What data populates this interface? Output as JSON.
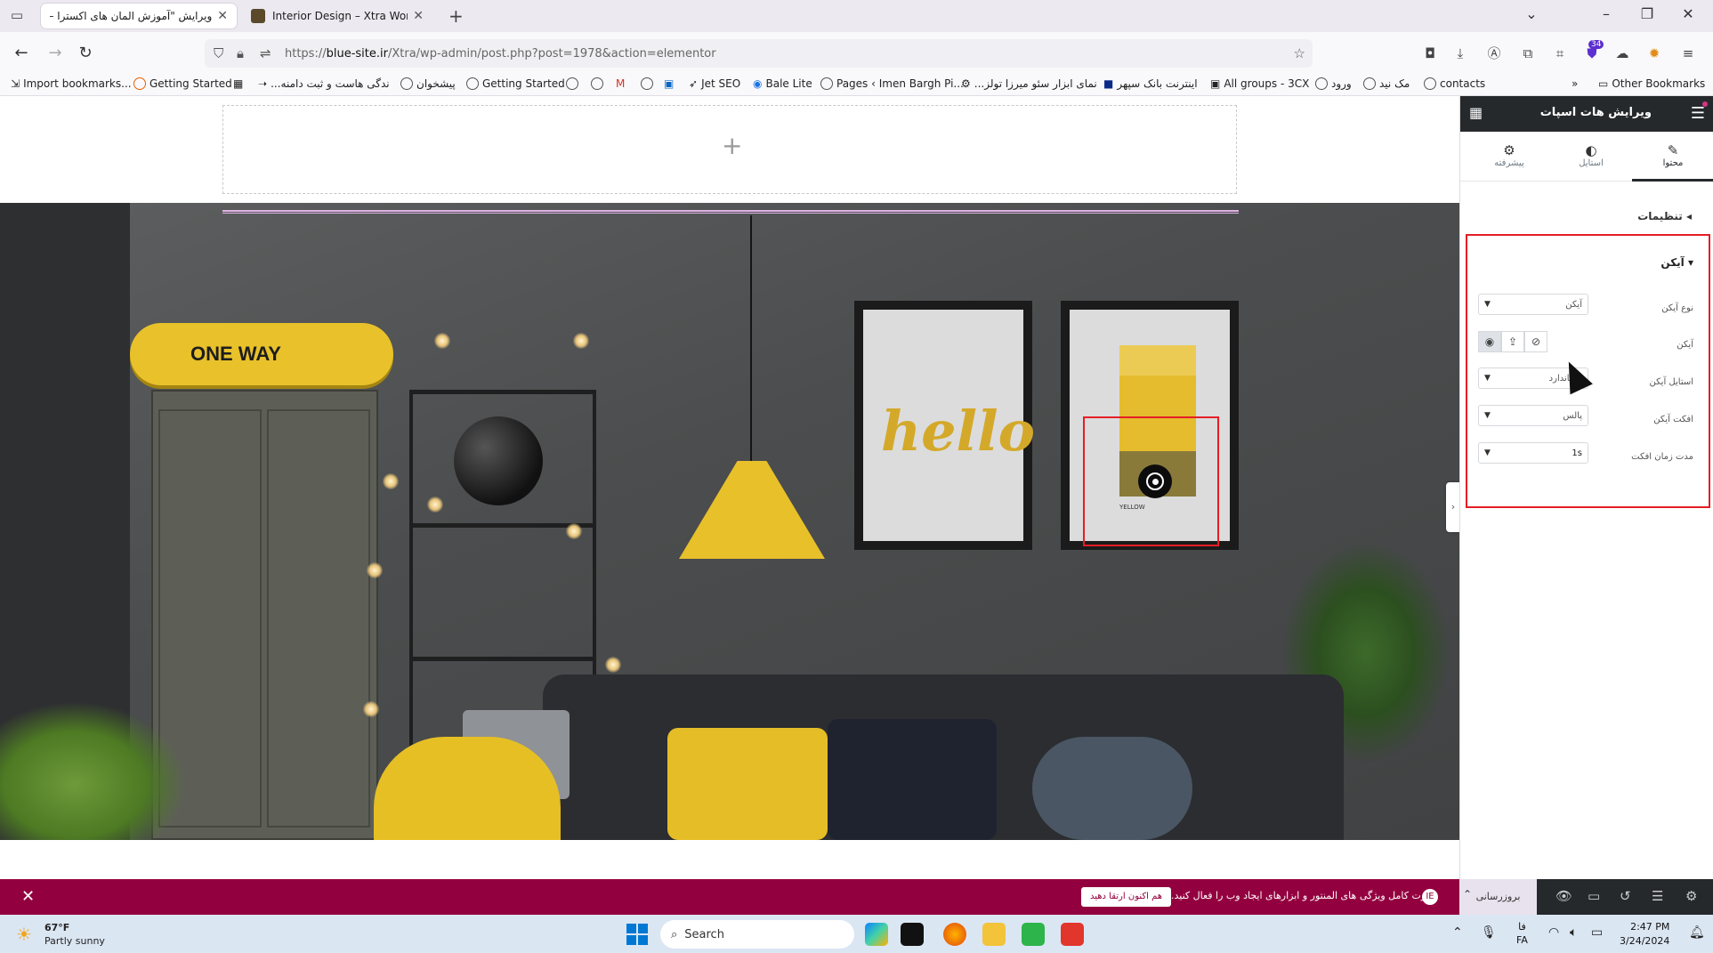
{
  "browser": {
    "tabs": [
      {
        "title": "ویرایش \"آموزش المان های اکسترا –",
        "active": true
      },
      {
        "title": "Interior Design – Xtra WordPress",
        "active": false
      }
    ],
    "url": {
      "prefix": "https://",
      "domain": "blue-site.ir",
      "path": "/Xtra/wp-admin/post.php?post=1978&action=elementor"
    },
    "extension_badge": "34",
    "bookmarks": [
      "Import bookmarks...",
      "Getting Started",
      "...ندگی هاست و ثبت دامنه",
      "پیشخوان",
      "Getting Started",
      "Jet SEO",
      "Bale Lite",
      "Pages ‹ Imen Bargh Pi...",
      "...نمای ابزار سئو میرزا تولز",
      "اینترنت بانک سپهر",
      "All groups - 3CX",
      "ورود",
      "مک نید",
      "contacts"
    ],
    "other_bookmarks": "Other Bookmarks"
  },
  "canvas": {
    "add_section_icon": "+",
    "skateboard_text": "ONE WAY",
    "frame_hello": "hello",
    "swatch_label": "YELLOW"
  },
  "panel": {
    "title": "ویرایش هات اسپات",
    "tabs": [
      {
        "label": "محتوا",
        "icon": "pencil-icon"
      },
      {
        "label": "استایل",
        "icon": "contrast-icon"
      },
      {
        "label": "پیشرفته",
        "icon": "gear-icon"
      }
    ],
    "section": "تنظیمات",
    "subsection": "آیکن",
    "fields": {
      "icon_type_label": "نوع آیکن",
      "icon_type_value": "آیکن",
      "icon_label": "آیکن",
      "icon_style_label": "استایل آیکن",
      "icon_style_value": "استاندارد",
      "icon_effect_label": "افکت آیکن",
      "icon_effect_value": "پالس",
      "effect_duration_label": "مدت زمان افکت",
      "effect_duration_value": "1s"
    }
  },
  "footer": {
    "promo_text": "قدرت کامل ویژگی های المنتور و ابزارهای ایجاد وب را فعال کنید.",
    "promo_button": "هم اکنون ارتقا دهید",
    "update_button": "بروزرسانی"
  },
  "taskbar": {
    "weather_temp": "67°F",
    "weather_desc": "Partly sunny",
    "search_placeholder": "Search",
    "lang_line1": "فا",
    "lang_line2": "FA",
    "time": "2:47 PM",
    "date": "3/24/2024"
  },
  "colors": {
    "selection_red": "#e51e25",
    "footer_maroon": "#93003f",
    "panel_dark": "#26292c",
    "accent_yellow": "#e7c02a"
  }
}
